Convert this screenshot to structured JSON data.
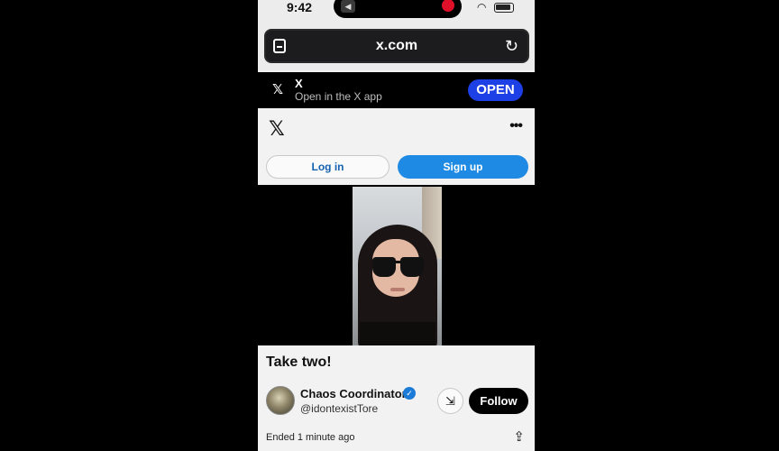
{
  "status_bar": {
    "time": "9:42"
  },
  "url_bar": {
    "url": "x.com"
  },
  "app_banner": {
    "logo": "𝕏",
    "title": "X",
    "subtitle": "Open in the X app",
    "open_label": "OPEN"
  },
  "header": {
    "logo": "𝕏",
    "more": "•••"
  },
  "auth": {
    "login_label": "Log in",
    "signup_label": "Sign up"
  },
  "post": {
    "text": "Take two!",
    "author_name": "Chaos Coordinator",
    "author_handle": "@idontexistTore",
    "follow_label": "Follow",
    "meta": "Ended 1 minute ago"
  },
  "icons": {
    "reload": "↻",
    "wifi": "◠",
    "verified": "✓",
    "share_post": "⇲",
    "upload": "⇪",
    "speaker": "◀"
  },
  "colors": {
    "accent": "#1e8ae3",
    "open_button": "#1d3fe6",
    "verified": "#1d7bd8",
    "record": "#e0102a"
  }
}
